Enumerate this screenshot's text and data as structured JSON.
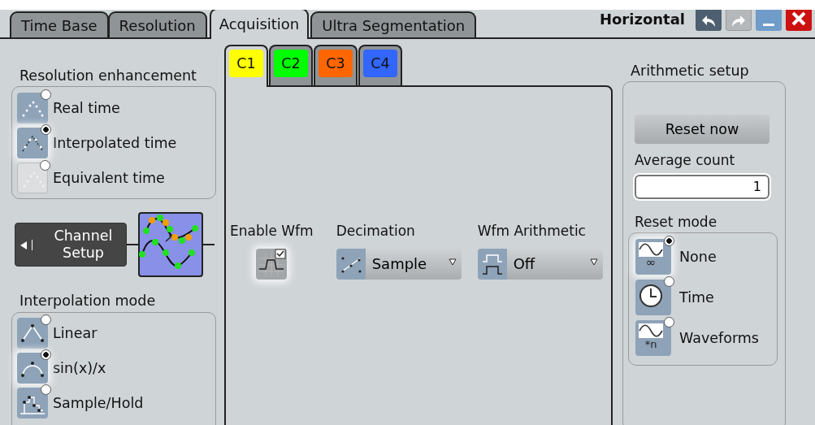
{
  "tabs": [
    {
      "label": "Time Base",
      "selected": false
    },
    {
      "label": "Resolution",
      "selected": false
    },
    {
      "label": "Acquisition",
      "selected": true
    },
    {
      "label": "Ultra Segmentation",
      "selected": false
    }
  ],
  "window": {
    "title": "Horizontal",
    "buttons": [
      {
        "kind": "undo",
        "disabled": false
      },
      {
        "kind": "redo",
        "disabled": true
      },
      {
        "kind": "minimize",
        "disabled": false
      },
      {
        "kind": "close",
        "disabled": false
      }
    ]
  },
  "resolution_enhancement": {
    "title": "Resolution enhancement",
    "options": [
      {
        "label": "Real time",
        "kind": "dots-real",
        "selected": false,
        "disabled": false
      },
      {
        "label": "Interpolated time",
        "kind": "dots-interp",
        "selected": true,
        "disabled": false
      },
      {
        "label": "Equivalent time",
        "kind": "dots-real",
        "selected": false,
        "disabled": true
      }
    ]
  },
  "channel_setup": {
    "label": "Channel Setup"
  },
  "interpolation_mode": {
    "title": "Interpolation mode",
    "options": [
      {
        "label": "Linear",
        "kind": "linear",
        "selected": false,
        "disabled": false
      },
      {
        "label": "sin(x)/x",
        "kind": "sinx",
        "selected": true,
        "disabled": false
      },
      {
        "label": "Sample/Hold",
        "kind": "hold",
        "selected": false,
        "disabled": false
      }
    ]
  },
  "channels": [
    {
      "label": "C1",
      "color": "#ffff00",
      "selected": true
    },
    {
      "label": "C2",
      "color": "#00ff00",
      "selected": false
    },
    {
      "label": "C3",
      "color": "#ff6600",
      "selected": false
    },
    {
      "label": "C4",
      "color": "#3366ff",
      "selected": false
    }
  ],
  "channel_panel": {
    "enable_wfm": {
      "label": "Enable Wfm",
      "checked": true
    },
    "decimation": {
      "label": "Decimation",
      "value": "Sample"
    },
    "wfm_arithmetic": {
      "label": "Wfm Arithmetic",
      "value": "Off"
    }
  },
  "arithmetic_setup": {
    "title": "Arithmetic setup",
    "reset_button": "Reset now",
    "average_count": {
      "label": "Average count",
      "value": "1"
    },
    "reset_mode": {
      "title": "Reset mode",
      "options": [
        {
          "label": "None",
          "kind": "wave",
          "caption": "∞",
          "selected": true
        },
        {
          "label": "Time",
          "kind": "clock",
          "selected": false
        },
        {
          "label": "Waveforms",
          "kind": "wave",
          "caption": "*n",
          "selected": false
        }
      ]
    }
  }
}
